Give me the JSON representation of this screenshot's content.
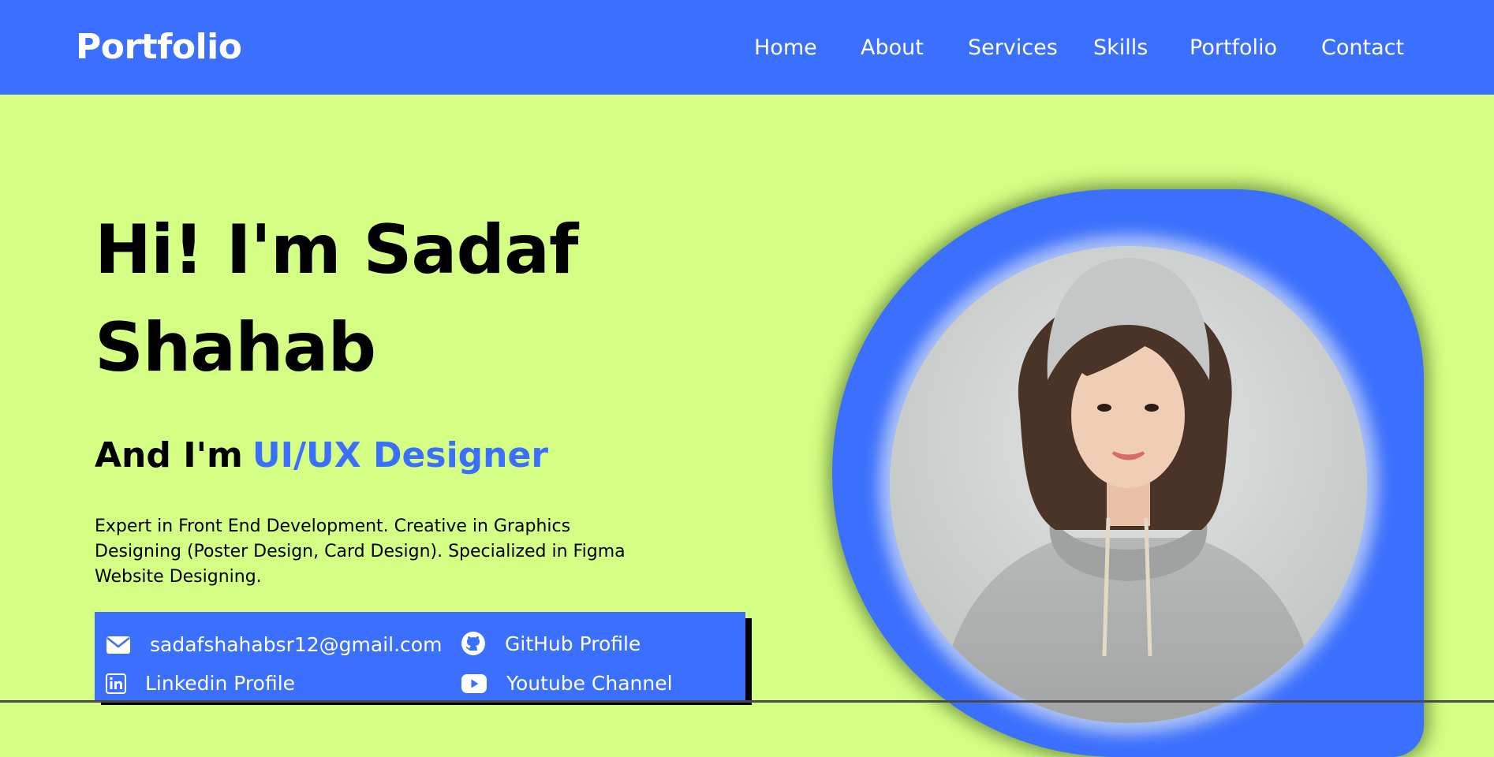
{
  "nav": {
    "brand": "Portfolio",
    "links": [
      "Home",
      "About",
      "Services",
      "Skills",
      "Portfolio",
      "Contact"
    ]
  },
  "hero": {
    "greeting": "Hi! I'm Sadaf Shahab",
    "role_prefix": "And I'm",
    "role": "UI/UX Designer",
    "description": "Expert in Front End Development. Creative in Graphics Designing (Poster Design, Card Design). Specialized in Figma Website Designing."
  },
  "contacts": {
    "email": {
      "label": "sadafshahabsr12@gmail.com",
      "icon": "envelope-icon"
    },
    "github": {
      "label": "GitHub Profile",
      "icon": "github-icon"
    },
    "linkedin": {
      "label": "Linkedin Profile",
      "icon": "linkedin-icon"
    },
    "youtube": {
      "label": "Youtube Channel",
      "icon": "youtube-icon"
    }
  },
  "colors": {
    "accent": "#3b6ffd",
    "background": "#d4ff84",
    "text": "#000000"
  }
}
